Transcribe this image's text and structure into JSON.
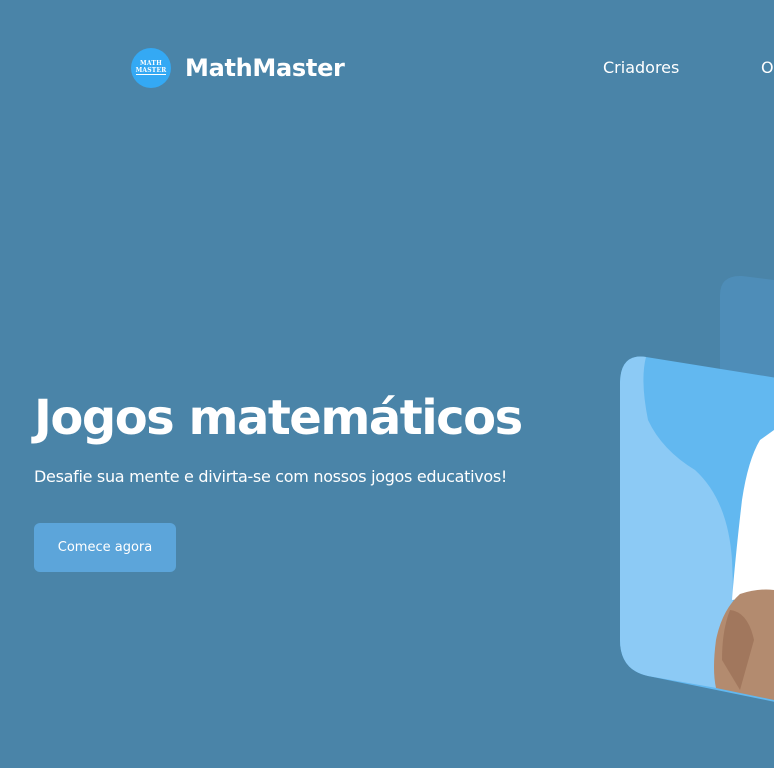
{
  "header": {
    "logo_badge_line1": "MATH",
    "logo_badge_line2": "MASTER",
    "brand": "MathMaster",
    "nav": [
      {
        "label": "Criadores"
      },
      {
        "label": "O"
      }
    ]
  },
  "hero": {
    "title": "Jogos matemáticos",
    "subtitle": "Desafie sua mente e divirta-se com nossos jogos educativos!",
    "cta_label": "Comece agora"
  },
  "colors": {
    "background": "#4a84a8",
    "logo_badge": "#34a9f4",
    "cta": "#5ca5da",
    "card_back": "#4e8db8",
    "card_front": "#62b8f0",
    "card_wave": "#8ccaf5"
  },
  "illustration": {
    "icon": "person-photo-card"
  }
}
